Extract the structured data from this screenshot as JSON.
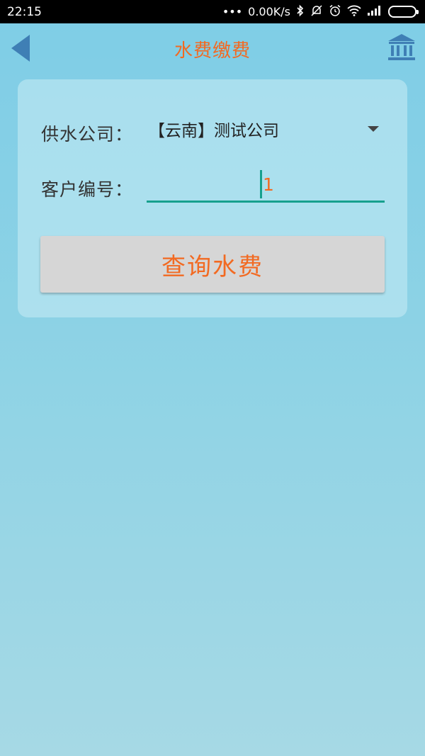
{
  "status_bar": {
    "time": "22:15",
    "dots": "•••",
    "network_speed": "0.00K/s",
    "icons": [
      "bluetooth-icon",
      "alarm-off-icon",
      "alarm-icon",
      "wifi-icon",
      "signal-icon",
      "battery-icon"
    ]
  },
  "app_bar": {
    "title": "水费缴费",
    "back_icon": "back-arrow-icon",
    "action_icon": "bank-icon"
  },
  "form": {
    "company_label": "供水公司：",
    "company_value": "【云南】测试公司",
    "customer_label": "客户编号：",
    "customer_value": "1",
    "query_button": "查询水费"
  },
  "colors": {
    "accent": "#f26a22",
    "input_underline": "#16a08d",
    "icon_blue": "#3f7fb5",
    "background": "#7ecde6"
  }
}
